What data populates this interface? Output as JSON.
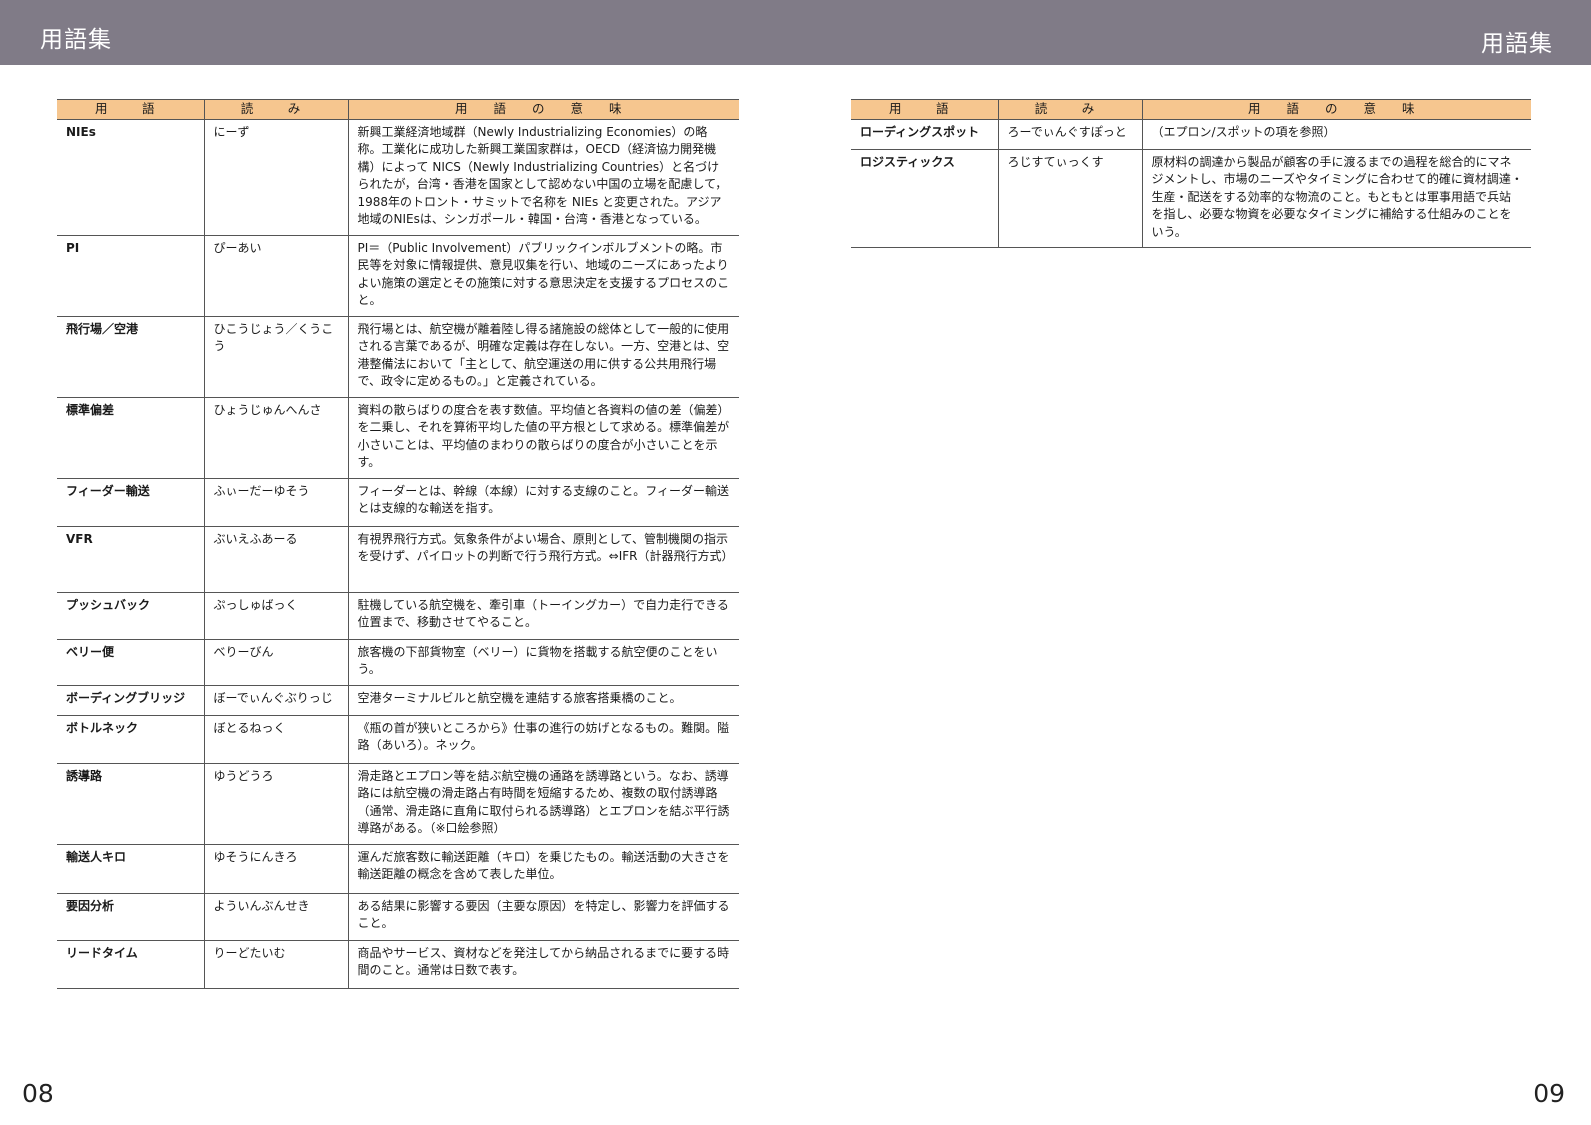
{
  "header": {
    "left_title": "用語集",
    "right_title": "用語集"
  },
  "table_headers": {
    "term": "用　語",
    "reading": "読　み",
    "meaning": "用 語 の 意 味"
  },
  "left_rows": [
    {
      "term": "NIEs",
      "reading": "にーず",
      "meaning": "新興工業経済地域群（Newly Industrializing Economies）の略称。工業化に成功した新興工業国家群は，OECD（経済協力開発機構）によって NICS（Newly Industrializing Countries）と名づけられたが，台湾・香港を国家として認めない中国の立場を配慮して，1988年のトロント・サミットで名称を NIEs と変更された。アジア地域のNIEsは、シンガポール・韓国・台湾・香港となっている。"
    },
    {
      "term": "PI",
      "reading": "ぴーあい",
      "meaning": "PI＝（Public Involvement）パブリックインボルブメントの略。市民等を対象に情報提供、意見収集を行い、地域のニーズにあったよりよい施策の選定とその施策に対する意思決定を支援するプロセスのこと。"
    },
    {
      "term": "飛行場／空港",
      "reading": "ひこうじょう／くうこう",
      "meaning": "飛行場とは、航空機が離着陸し得る諸施設の総体として一般的に使用される言葉であるが、明確な定義は存在しない。一方、空港とは、空港整備法において「主として、航空運送の用に供する公共用飛行場で、政令に定めるもの。」と定義されている。"
    },
    {
      "term": "標準偏差",
      "reading": "ひょうじゅんへんさ",
      "meaning": "資料の散らばりの度合を表す数値。平均値と各資料の値の差（偏差）を二乗し、それを算術平均した値の平方根として求める。標準偏差が小さいことは、平均値のまわりの散らばりの度合が小さいことを示す。"
    },
    {
      "term": "フィーダー輸送",
      "reading": "ふぃーだーゆそう",
      "meaning": "フィーダーとは、幹線（本線）に対する支線のこと。フィーダー輸送とは支線的な輸送を指す。"
    },
    {
      "term": "VFR",
      "reading": "ぶいえふあーる",
      "meaning": "有視界飛行方式。気象条件がよい場合、原則として、管制機関の指示を受けず、パイロットの判断で行う飛行方式。⇔IFR（計器飛行方式）"
    },
    {
      "term": "プッシュバック",
      "reading": "ぷっしゅばっく",
      "meaning": "駐機している航空機を、牽引車（トーイングカー）で自力走行できる位置まで、移動させてやること。"
    },
    {
      "term": "ベリー便",
      "reading": "べりーびん",
      "meaning": "旅客機の下部貨物室（ベリー）に貨物を搭載する航空便のことをいう。"
    },
    {
      "term": "ボーディングブリッジ",
      "reading": "ぼーでぃんぐぶりっじ",
      "meaning": "空港ターミナルビルと航空機を連結する旅客搭乗橋のこと。"
    },
    {
      "term": "ボトルネック",
      "reading": "ぼとるねっく",
      "meaning": "《瓶の首が狭いところから》仕事の進行の妨げとなるもの。難関。隘路（あいろ）。ネック。"
    },
    {
      "term": "誘導路",
      "reading": "ゆうどうろ",
      "meaning": "滑走路とエプロン等を結ぶ航空機の通路を誘導路という。なお、誘導路には航空機の滑走路占有時間を短縮するため、複数の取付誘導路（通常、滑走路に直角に取付られる誘導路）とエプロンを結ぶ平行誘導路がある。（※口絵参照）"
    },
    {
      "term": "輸送人キロ",
      "reading": "ゆそうにんきろ",
      "meaning": "運んだ旅客数に輸送距離（キロ）を乗じたもの。輸送活動の大きさを輸送距離の概念を含めて表した単位。"
    },
    {
      "term": "要因分析",
      "reading": "よういんぶんせき",
      "meaning": "ある結果に影響する要因（主要な原因）を特定し、影響力を評価すること。"
    },
    {
      "term": "リードタイム",
      "reading": "りーどたいむ",
      "meaning": "商品やサービス、資材などを発注してから納品されるまでに要する時間のこと。通常は日数で表す。"
    }
  ],
  "right_rows": [
    {
      "term": "ローディングスポット",
      "reading": "ろーでぃんぐすぽっと",
      "meaning": "（エプロン/スポットの項を参照）"
    },
    {
      "term": "ロジスティックス",
      "reading": "ろじすてぃっくす",
      "meaning": "原材料の調達から製品が顧客の手に渡るまでの過程を総合的にマネジメントし、市場のニーズやタイミングに合わせて的確に資材調達・生産・配送をする効率的な物流のこと。もともとは軍事用語で兵站を指し、必要な物資を必要なタイミングに補給する仕組みのことをいう。"
    }
  ],
  "page_numbers": {
    "left": "08",
    "right": "09"
  }
}
